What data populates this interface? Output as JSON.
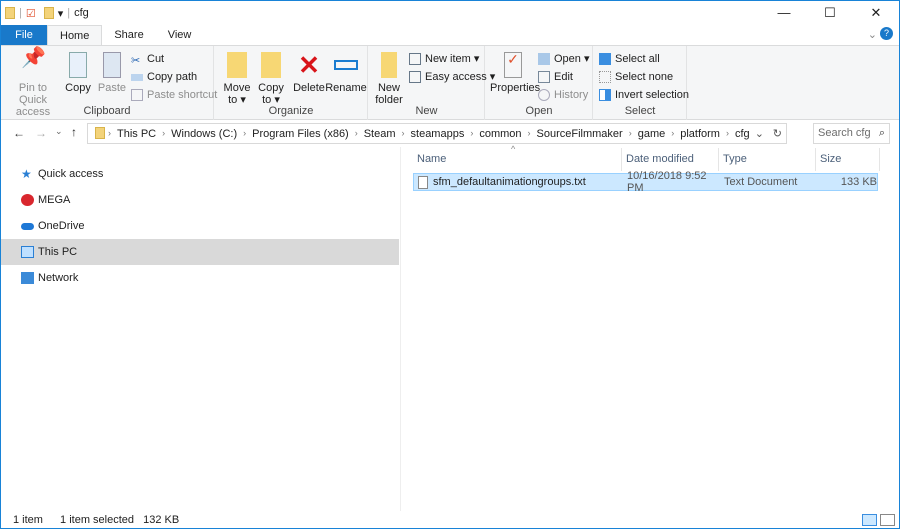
{
  "title": {
    "text": "cfg"
  },
  "window_controls": {
    "minimize": "—",
    "maximize": "☐",
    "close": "✕",
    "help": "?"
  },
  "tabs": [
    {
      "label": "File"
    },
    {
      "label": "Home"
    },
    {
      "label": "Share"
    },
    {
      "label": "View"
    }
  ],
  "ribbon": {
    "clipboard": {
      "label": "Clipboard",
      "pin": "Pin to Quick access",
      "copy": "Copy",
      "paste": "Paste",
      "cut": "Cut",
      "copy_path": "Copy path",
      "paste_shortcut": "Paste shortcut"
    },
    "organize": {
      "label": "Organize",
      "move_to": "Move to ▾",
      "copy_to": "Copy to ▾",
      "delete": "Delete",
      "rename": "Rename"
    },
    "new": {
      "label": "New",
      "new_folder": "New folder",
      "new_item": "New item ▾",
      "easy_access": "Easy access ▾"
    },
    "open": {
      "label": "Open",
      "properties": "Properties",
      "open": "Open ▾",
      "edit": "Edit",
      "history": "History"
    },
    "select": {
      "label": "Select",
      "select_all": "Select all",
      "select_none": "Select none",
      "invert": "Invert selection"
    }
  },
  "address": {
    "crumbs": [
      "This PC",
      "Windows (C:)",
      "Program Files (x86)",
      "Steam",
      "steamapps",
      "common",
      "SourceFilmmaker",
      "game",
      "platform",
      "cfg"
    ]
  },
  "search": {
    "placeholder": "Search cfg"
  },
  "nav": [
    {
      "label": "Quick access",
      "icon": "star-icon"
    },
    {
      "label": "MEGA",
      "icon": "mega-icon"
    },
    {
      "label": "OneDrive",
      "icon": "cloud-icon"
    },
    {
      "label": "This PC",
      "icon": "computer-icon",
      "selected": true
    },
    {
      "label": "Network",
      "icon": "network-icon"
    }
  ],
  "columns": [
    "Name",
    "Date modified",
    "Type",
    "Size"
  ],
  "files": [
    {
      "name": "sfm_defaultanimationgroups.txt",
      "date": "10/16/2018 9:52 PM",
      "type": "Text Document",
      "size": "133 KB",
      "selected": true
    }
  ],
  "status": {
    "count": "1 item",
    "selected": "1 item selected",
    "size": "132 KB"
  },
  "colors": {
    "accent": "#1979ca",
    "selection": "#cce8ff"
  }
}
